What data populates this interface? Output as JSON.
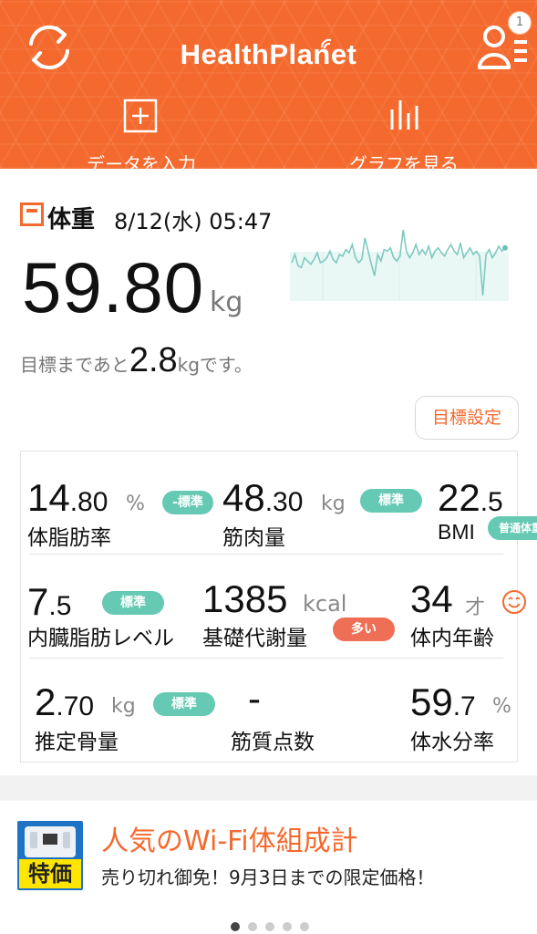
{
  "header": {
    "app_title": "HealthPlanet",
    "notification_count": "1",
    "menu": [
      {
        "label": "データを入力",
        "icon": "plus-square-icon"
      },
      {
        "label": "グラフを見る",
        "icon": "bar-chart-icon"
      }
    ]
  },
  "weight": {
    "label": "体重",
    "date": "8/12(水) 05:47",
    "value": "59.80",
    "unit": "kg",
    "goal_prefix": "目標まであと",
    "goal_diff": "2.8",
    "goal_suffix": "kgです。",
    "goal_button": "目標設定"
  },
  "metrics": {
    "body_fat": {
      "int": "14",
      "dec": ".80",
      "unit": "%",
      "label": "体脂肪率",
      "status": "-標準"
    },
    "muscle": {
      "int": "48",
      "dec": ".30",
      "unit": "kg",
      "label": "筋肉量",
      "status": "標準"
    },
    "bmi": {
      "int": "22",
      "dec": ".5",
      "label": "BMI",
      "status": "普通体重"
    },
    "visceral": {
      "int": "7",
      "dec": ".5",
      "label": "内臓脂肪レベル",
      "status": "標準"
    },
    "basal": {
      "value": "1385",
      "unit": "kcal",
      "label": "基礎代謝量",
      "status": "多い"
    },
    "body_age": {
      "value": "34",
      "unit": "才",
      "label": "体内年齢",
      "icon": "smiley-face-icon"
    },
    "bone": {
      "int": "2",
      "dec": ".70",
      "unit": "kg",
      "label": "推定骨量",
      "status": "標準"
    },
    "muscle_quality": {
      "value": "-",
      "label": "筋質点数"
    },
    "water": {
      "int": "59",
      "dec": ".7",
      "unit": "%",
      "label": "体水分率"
    }
  },
  "ad": {
    "badge": "特価",
    "title": "人気のWi-Fi体組成計",
    "description": "売り切れ御免！9月3日までの限定価格！"
  },
  "pager": {
    "count": 5,
    "active_index": 0
  },
  "colors": {
    "brand": "#f4692d",
    "standard": "#66c9b4",
    "high": "#ef6f56"
  },
  "sparkline": {
    "type": "line",
    "values": [
      55,
      60,
      53,
      52,
      58,
      56,
      54,
      57,
      61,
      55,
      56,
      58,
      62,
      57,
      55,
      60,
      59,
      63,
      61,
      66,
      58,
      55,
      57,
      70,
      62,
      54,
      47,
      60,
      56,
      63,
      62,
      64,
      58,
      56,
      59,
      75,
      62,
      58,
      61,
      66,
      60,
      63,
      60,
      65,
      58,
      62,
      64,
      61,
      59,
      63,
      66,
      62,
      60,
      67,
      58,
      61,
      64,
      60,
      62,
      59,
      35,
      60,
      63,
      58,
      61,
      65,
      62,
      64
    ]
  }
}
